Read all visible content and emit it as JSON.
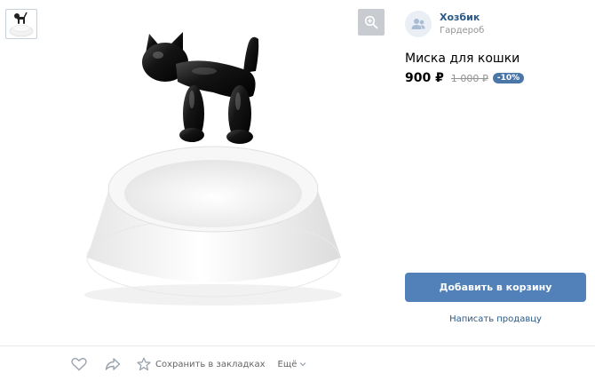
{
  "gallery": {
    "thumbnail_count": 1,
    "zoom_icon": "zoom-in-icon"
  },
  "product": {
    "title": "Миска для кошки",
    "price": "900 ₽",
    "old_price": "1 000 ₽",
    "discount": "-10%"
  },
  "seller": {
    "name": "Хозбик",
    "category": "Гардероб",
    "avatar_icon": "group-icon"
  },
  "buttons": {
    "add_to_cart": "Добавить в корзину",
    "write_seller": "Написать продавцу"
  },
  "actions": {
    "like_icon": "heart-icon",
    "share_icon": "share-arrow-icon",
    "bookmark_icon": "star-icon",
    "bookmark_label": "Сохранить в закладках",
    "more_label": "Ещё"
  },
  "colors": {
    "accent": "#5181b8",
    "link": "#2a5885",
    "badge": "#4a76a8",
    "muted": "#939393"
  }
}
